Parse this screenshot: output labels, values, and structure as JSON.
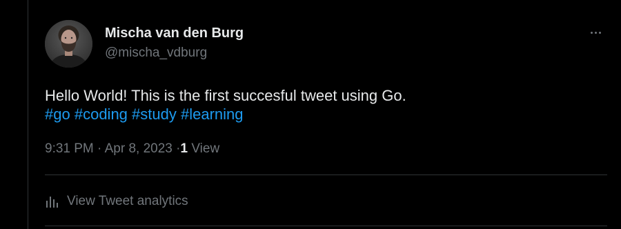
{
  "author": {
    "display_name": "Mischa van den Burg",
    "handle": "@mischa_vdburg",
    "avatar_icon": "user-avatar-photo"
  },
  "tweet": {
    "text": "Hello World! This is the first succesful tweet using Go.",
    "hashtags": [
      "#go",
      "#coding",
      "#study",
      "#learning"
    ]
  },
  "meta": {
    "time": "9:31 PM",
    "separator": "·",
    "date": "Apr 8, 2023",
    "views_count": "1",
    "views_label": "View"
  },
  "analytics": {
    "label": "View Tweet analytics",
    "icon": "bar-chart-icon"
  },
  "colors": {
    "background": "#000000",
    "text_primary": "#e7e9ea",
    "text_secondary": "#71767b",
    "link": "#1d9bf0",
    "border": "#2f3336"
  }
}
